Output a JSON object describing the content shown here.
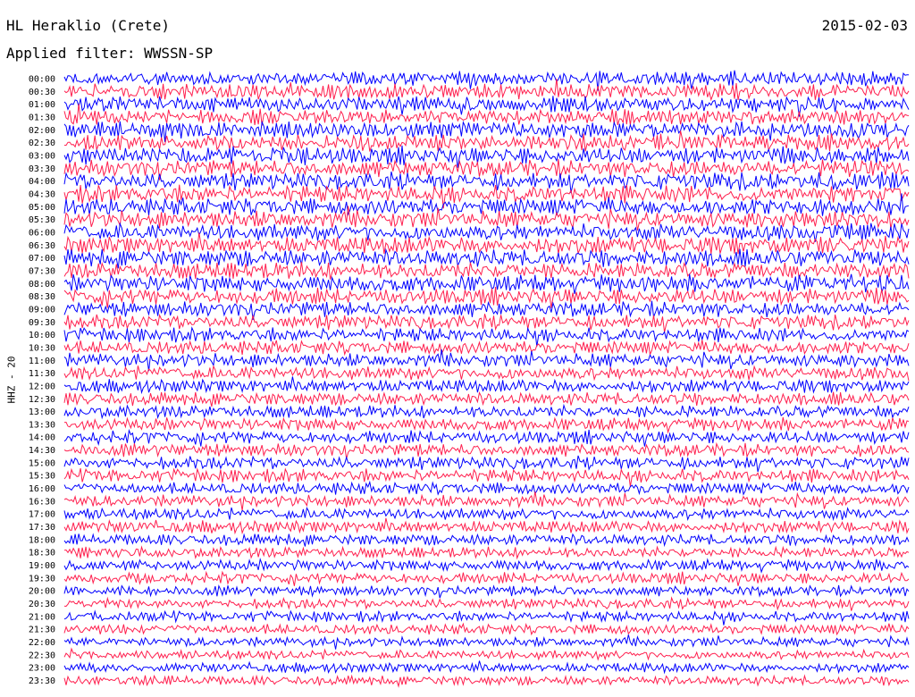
{
  "header": {
    "station": "HL Heraklio (Crete)",
    "date": "2015-02-03",
    "filter_label": "Applied filter: WWSSN-SP",
    "channel_label": "HHZ - 20"
  },
  "chart_data": {
    "type": "line",
    "title": "HL Heraklio (Crete)",
    "subtitle": "Applied filter: WWSSN-SP",
    "ylabel": "HHZ - 20",
    "date": "2015-02-03",
    "row_labels": [
      "00:00",
      "00:30",
      "01:00",
      "01:30",
      "02:00",
      "02:30",
      "03:00",
      "03:30",
      "04:00",
      "04:30",
      "05:00",
      "05:30",
      "06:00",
      "06:30",
      "07:00",
      "07:30",
      "08:00",
      "08:30",
      "09:00",
      "09:30",
      "10:00",
      "10:30",
      "11:00",
      "11:30",
      "12:00",
      "12:30",
      "13:00",
      "13:30",
      "14:00",
      "14:30",
      "15:00",
      "15:30",
      "16:00",
      "16:30",
      "17:00",
      "17:30",
      "18:00",
      "18:30",
      "19:00",
      "19:30",
      "20:00",
      "20:30",
      "21:00",
      "21:30",
      "22:00",
      "22:30",
      "23:00",
      "23:30"
    ],
    "trace_colors": [
      "#0000ff",
      "#ff1f4e"
    ],
    "relative_amplitude": [
      0.85,
      0.9,
      0.9,
      0.9,
      0.95,
      0.95,
      1.0,
      1.0,
      1.0,
      1.0,
      1.0,
      1.0,
      1.0,
      1.0,
      1.0,
      1.0,
      1.0,
      0.95,
      0.9,
      0.85,
      0.8,
      0.8,
      0.8,
      0.8,
      0.75,
      0.75,
      0.75,
      0.75,
      0.75,
      0.75,
      0.75,
      0.75,
      0.7,
      0.7,
      0.7,
      0.7,
      0.65,
      0.65,
      0.65,
      0.65,
      0.6,
      0.6,
      0.6,
      0.6,
      0.55,
      0.55,
      0.55,
      0.55
    ],
    "grid": false,
    "legend": "none"
  }
}
